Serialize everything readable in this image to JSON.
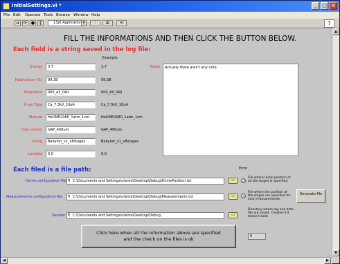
{
  "window": {
    "title": "InitialSettings.vi *",
    "controls": [
      "_",
      "□",
      "×"
    ]
  },
  "menu": [
    "File",
    "Edit",
    "Operate",
    "Tools",
    "Browse",
    "Window",
    "Help"
  ],
  "toolbar": {
    "font": "13pt Application Font",
    "help_icon": "help-icon"
  },
  "panel": {
    "headline": "FILL THE INFORMATIONS AND THEN CLICK THE BUTTON BELOW.",
    "strings_title": "Each field is a string saved in the log file:",
    "example_label": "Example",
    "fields": [
      {
        "label": "Energy",
        "value": "3.7",
        "example": "3.7"
      },
      {
        "label": "Polarisation (%)",
        "value": "99.38",
        "example": "99.38"
      },
      {
        "label": "Polarizator",
        "value": "000_All_040",
        "example": "000_All_040"
      },
      {
        "label": "X-ray Tube",
        "value": "Ca_7.3kV_10uA",
        "example": "Ca_7.3kV_10uA"
      },
      {
        "label": "Mixture",
        "value": "HeDME2080_1atm_1cm",
        "example": "HeDME2080_1atm_1cm"
      },
      {
        "label": "Chip version",
        "value": "GAP_400um",
        "example": "GAP_400um"
      },
      {
        "label": "Setup",
        "value": "Babylon_v1_x8stages",
        "example": "Babylon_v1_x8stages"
      },
      {
        "label": "Lambda",
        "value": "0.0",
        "example": "0.0"
      }
    ],
    "notes_label": "Notes",
    "notes_value": "Actually there aren't any note.",
    "files_title": "Each filed is a file path:",
    "error_label": "Error",
    "paths": [
      {
        "label": "Home configuration file",
        "value": "C:\\Documents and Settings\\utente\\Desktop\\Debug\\HomePosition.txt",
        "hint": "File where initial position of all the stages is specified."
      },
      {
        "label": "Measurements configuration file",
        "value": "C:\\Documents and Settings\\utente\\Desktop\\Debug\\Measurements.txt",
        "hint": "File where the position of the stages are specified for each measurements"
      },
      {
        "label": "Session",
        "value": "C:\\Documents and Settings\\utente\\Desktop\\Debug",
        "hint": "Directory where log and data file are saved. Created if it doesn't exist."
      }
    ],
    "generate_button": "Generate file",
    "main_button_line1": "Click here when all the information above are specified",
    "main_button_line2": "and the check on the files is ok",
    "counter_value": "0"
  }
}
